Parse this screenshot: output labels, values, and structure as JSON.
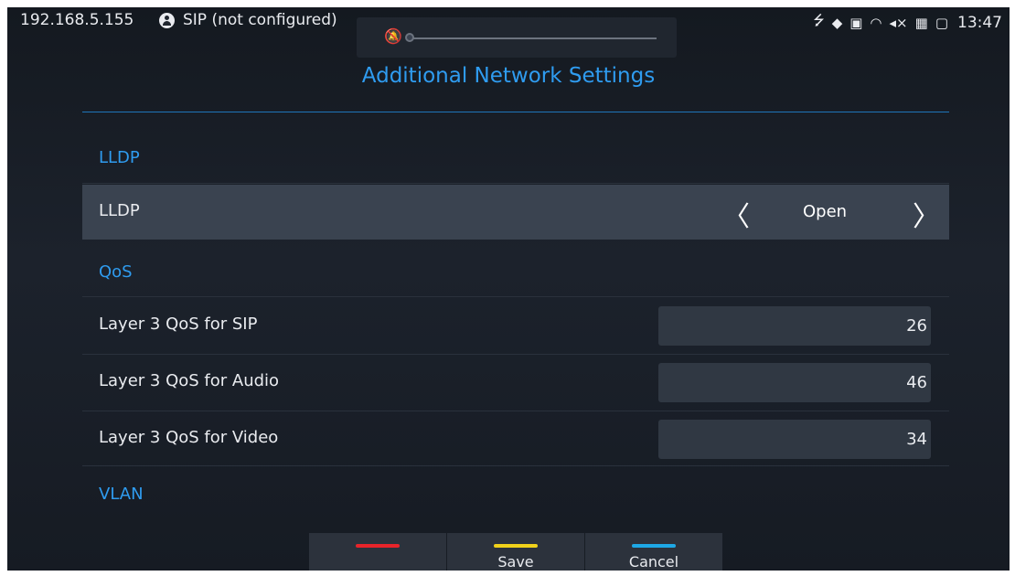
{
  "status_bar": {
    "ip": "192.168.5.155",
    "account_status": "SIP (not configured)",
    "time": "13:47",
    "icons": [
      "usb-icon",
      "shield-icon",
      "image-icon",
      "wifi-icon",
      "volume-muted-icon",
      "sim-icon",
      "network-off-icon"
    ]
  },
  "volume_overlay": {
    "level": 0,
    "muted": true
  },
  "page": {
    "title": "Additional Network Settings"
  },
  "sections": {
    "lldp": "LLDP",
    "qos": "QoS",
    "vlan": "VLAN"
  },
  "lldp_row": {
    "label": "LLDP",
    "value": "Open"
  },
  "qos_rows": [
    {
      "label": "Layer 3 QoS for SIP",
      "value": "26"
    },
    {
      "label": "Layer 3 QoS for Audio",
      "value": "46"
    },
    {
      "label": "Layer 3 QoS for Video",
      "value": "34"
    }
  ],
  "softkeys": [
    {
      "label": "",
      "color": "#e8242a"
    },
    {
      "label": "Save",
      "color": "#f0d11a"
    },
    {
      "label": "Cancel",
      "color": "#1ea8e6"
    }
  ],
  "colors": {
    "accent": "#2f9cf0",
    "selected_row": "#3a4350",
    "background": "#171c24"
  }
}
